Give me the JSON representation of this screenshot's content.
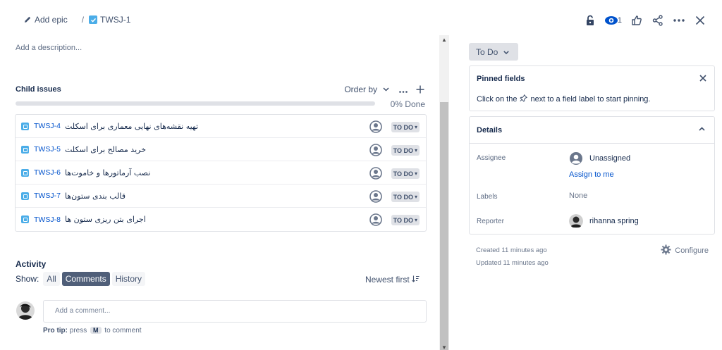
{
  "breadcrumb": {
    "add_epic": "Add epic",
    "separator": "/",
    "issue_key": "TWSJ-1"
  },
  "top_actions": {
    "watch_count": "1",
    "icons": [
      "lock-icon",
      "eye-icon",
      "thumbs-up-icon",
      "share-icon",
      "more-icon",
      "close-icon"
    ]
  },
  "description": {
    "placeholder": "Add a description..."
  },
  "child_issues": {
    "title": "Child issues",
    "order_by": "Order by",
    "progress_label": "0% Done",
    "progress_fraction": 0,
    "rows": [
      {
        "key": "TWSJ-4",
        "summary": "تهیه نقشه‌های نهایی معماری برای اسکلت",
        "status": "TO DO"
      },
      {
        "key": "TWSJ-5",
        "summary": "خرید مصالح برای اسکلت",
        "status": "TO DO"
      },
      {
        "key": "TWSJ-6",
        "summary": "نصب آرماتورها و خاموت‌ها",
        "status": "TO DO"
      },
      {
        "key": "TWSJ-7",
        "summary": "قالب بندی ستون‌ها",
        "status": "TO DO"
      },
      {
        "key": "TWSJ-8",
        "summary": "اجرای بتن ریزی ستون ها",
        "status": "TO DO"
      }
    ]
  },
  "activity": {
    "title": "Activity",
    "show_label": "Show:",
    "tabs": [
      "All",
      "Comments",
      "History"
    ],
    "active_tab": "Comments",
    "sort": "Newest first",
    "comment_placeholder": "Add a comment...",
    "protip_label": "Pro tip:",
    "protip_press": "press",
    "protip_key": "M",
    "protip_rest": "to comment"
  },
  "status_button": {
    "label": "To Do"
  },
  "pinned_fields": {
    "title": "Pinned fields",
    "text_before": "Click on the",
    "text_after": "next to a field label to start pinning."
  },
  "details": {
    "title": "Details",
    "assignee_label": "Assignee",
    "assignee_value": "Unassigned",
    "assign_to_me": "Assign to me",
    "labels_label": "Labels",
    "labels_value": "None",
    "reporter_label": "Reporter",
    "reporter_value": "rihanna spring"
  },
  "meta": {
    "created": "Created 11 minutes ago",
    "updated": "Updated 11 minutes ago",
    "configure": "Configure"
  },
  "colors": {
    "link": "#0052cc",
    "subtask": "#4bade8",
    "lozenge_bg": "#dfe1e6",
    "active_tab": "#505f79"
  }
}
